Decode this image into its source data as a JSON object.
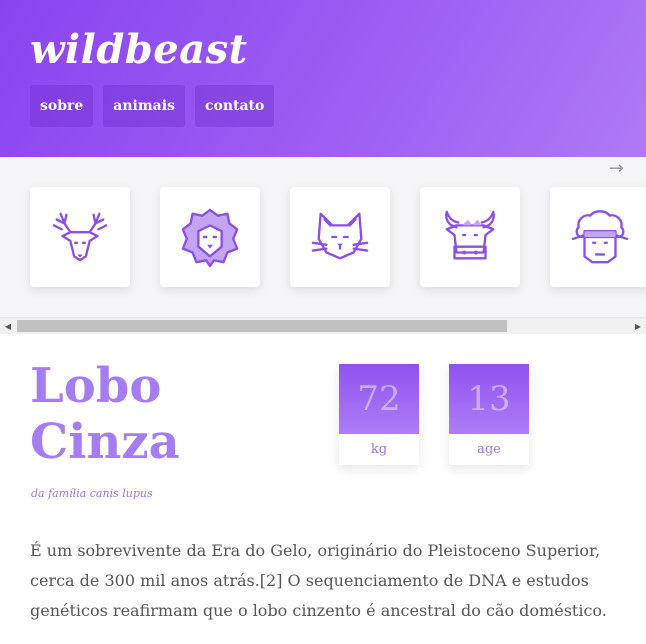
{
  "header": {
    "brand": "wildbeast",
    "nav": [
      "sobre",
      "animais",
      "contato"
    ]
  },
  "carousel": {
    "next_arrow": "→",
    "items": [
      {
        "icon": "deer-icon"
      },
      {
        "icon": "lion-icon"
      },
      {
        "icon": "cat-icon"
      },
      {
        "icon": "ox-icon"
      },
      {
        "icon": "sheep-icon"
      }
    ]
  },
  "animal": {
    "title_line1": "Lobo",
    "title_line2": "Cinza",
    "subtitle": "da família canis lupus",
    "stats": [
      {
        "value": "72",
        "label": "kg"
      },
      {
        "value": "13",
        "label": "age"
      }
    ],
    "description": "É um sobrevivente da Era do Gelo, originário do Pleistoceno Superior, cerca de 300 mil anos atrás.[2] O sequenciamento de DNA e estudos genéticos reafirmam que o lobo cinzento é ancestral do cão doméstico."
  },
  "colors": {
    "accent": "#9b5cf2",
    "header_gradient_start": "#8a44ef",
    "header_gradient_end": "#ad7af5",
    "title": "#a57cf2",
    "body_text": "#555555"
  }
}
